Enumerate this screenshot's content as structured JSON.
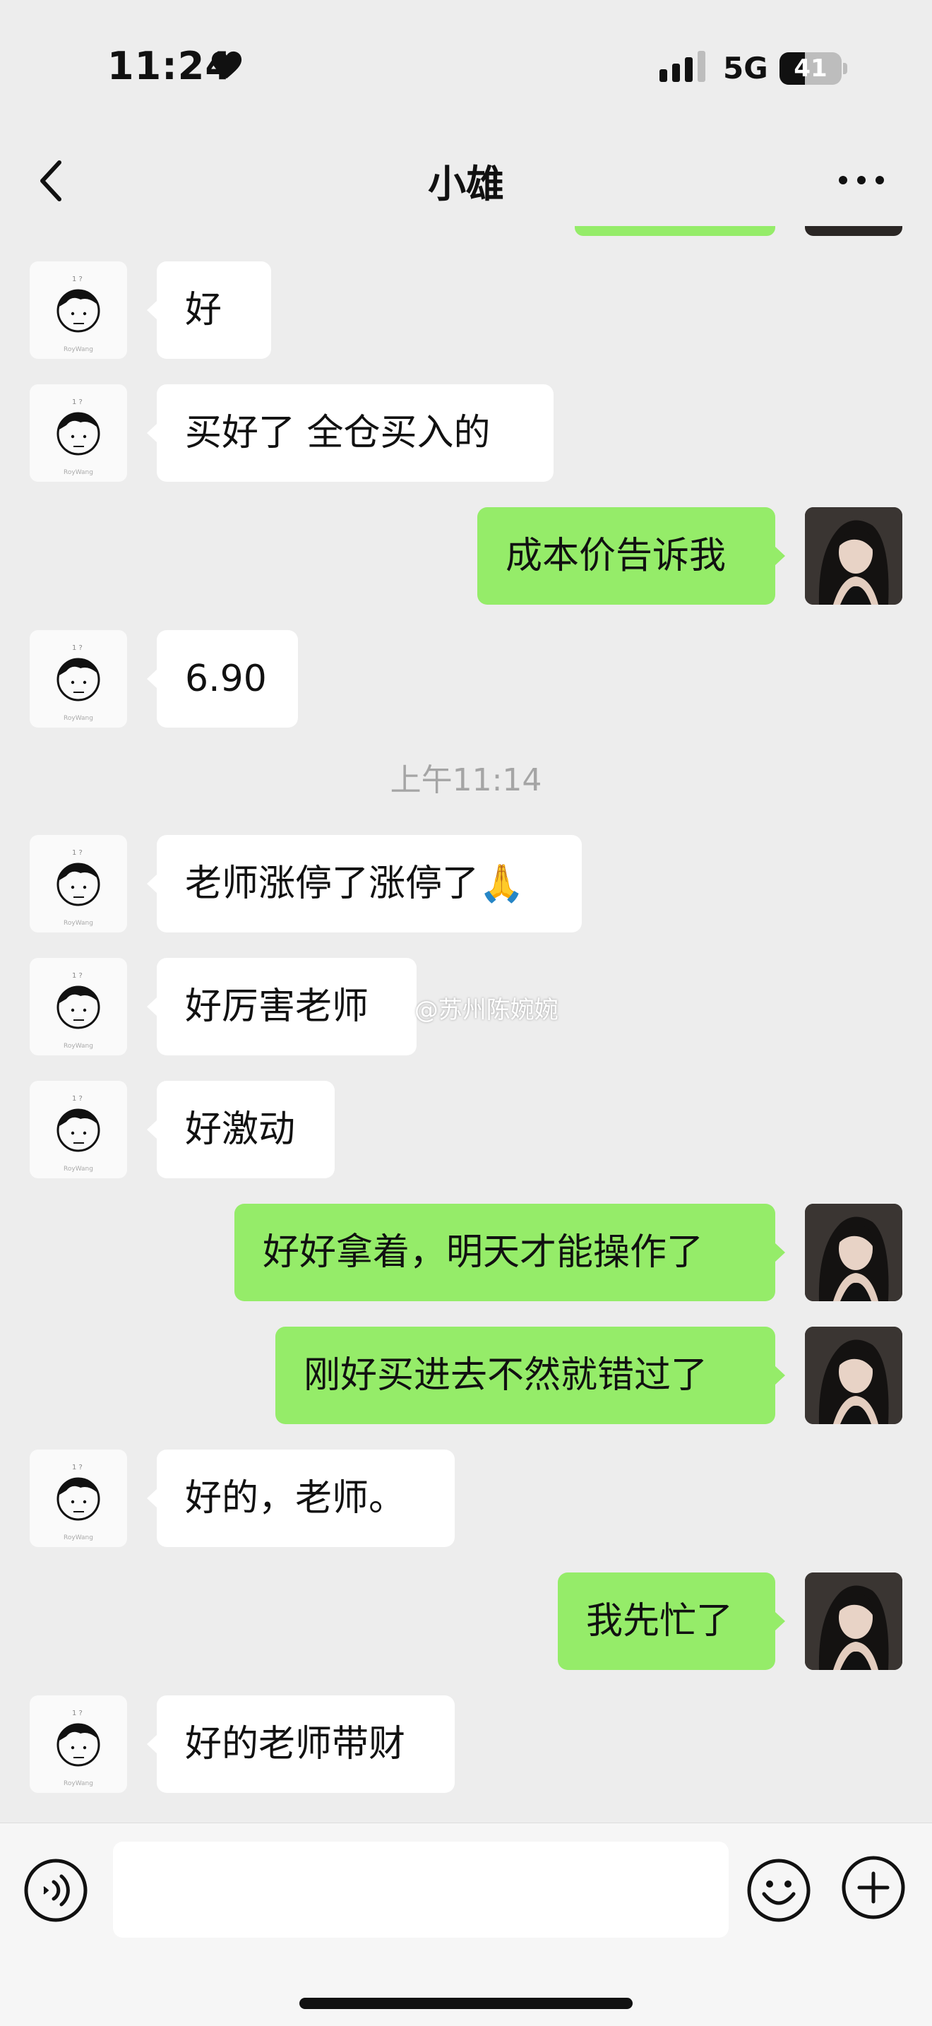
{
  "status_bar": {
    "time": "11:24",
    "network": "5G",
    "battery": "41",
    "battery_level": 0.41,
    "icons": [
      "heart-icon",
      "signal-icon",
      "battery-icon"
    ]
  },
  "nav": {
    "title": "小雄",
    "icons": [
      "back-arrow-icon",
      "more-dots-icon"
    ]
  },
  "chat": {
    "avatar_caption": "RoyWang",
    "timestamp": "上午11:14",
    "messages": [
      {
        "side": "in",
        "text": "好"
      },
      {
        "side": "in",
        "text": "买好了  全仓买入的"
      },
      {
        "side": "out",
        "text": "成本价告诉我"
      },
      {
        "side": "in",
        "text": "6.90"
      },
      {
        "side": "in",
        "text": "老师涨停了涨停了🙏"
      },
      {
        "side": "in",
        "text": "好厉害老师"
      },
      {
        "side": "in",
        "text": "好激动"
      },
      {
        "side": "out",
        "text": "好好拿着，明天才能操作了"
      },
      {
        "side": "out",
        "text": "刚好买进去不然就错过了"
      },
      {
        "side": "in",
        "text": "好的，老师。"
      },
      {
        "side": "out",
        "text": "我先忙了"
      },
      {
        "side": "in",
        "text": "好的老师带财"
      }
    ]
  },
  "watermark": {
    "text": "@苏州陈婉婉",
    "icon": "weibo-icon"
  },
  "input_bar": {
    "value": "",
    "icons": [
      "voice-icon",
      "emoji-icon",
      "plus-icon"
    ]
  },
  "colors": {
    "background": "#ededed",
    "outgoing_bubble": "#95ec69",
    "incoming_bubble": "#ffffff",
    "timestamp": "#a5a5a5"
  }
}
